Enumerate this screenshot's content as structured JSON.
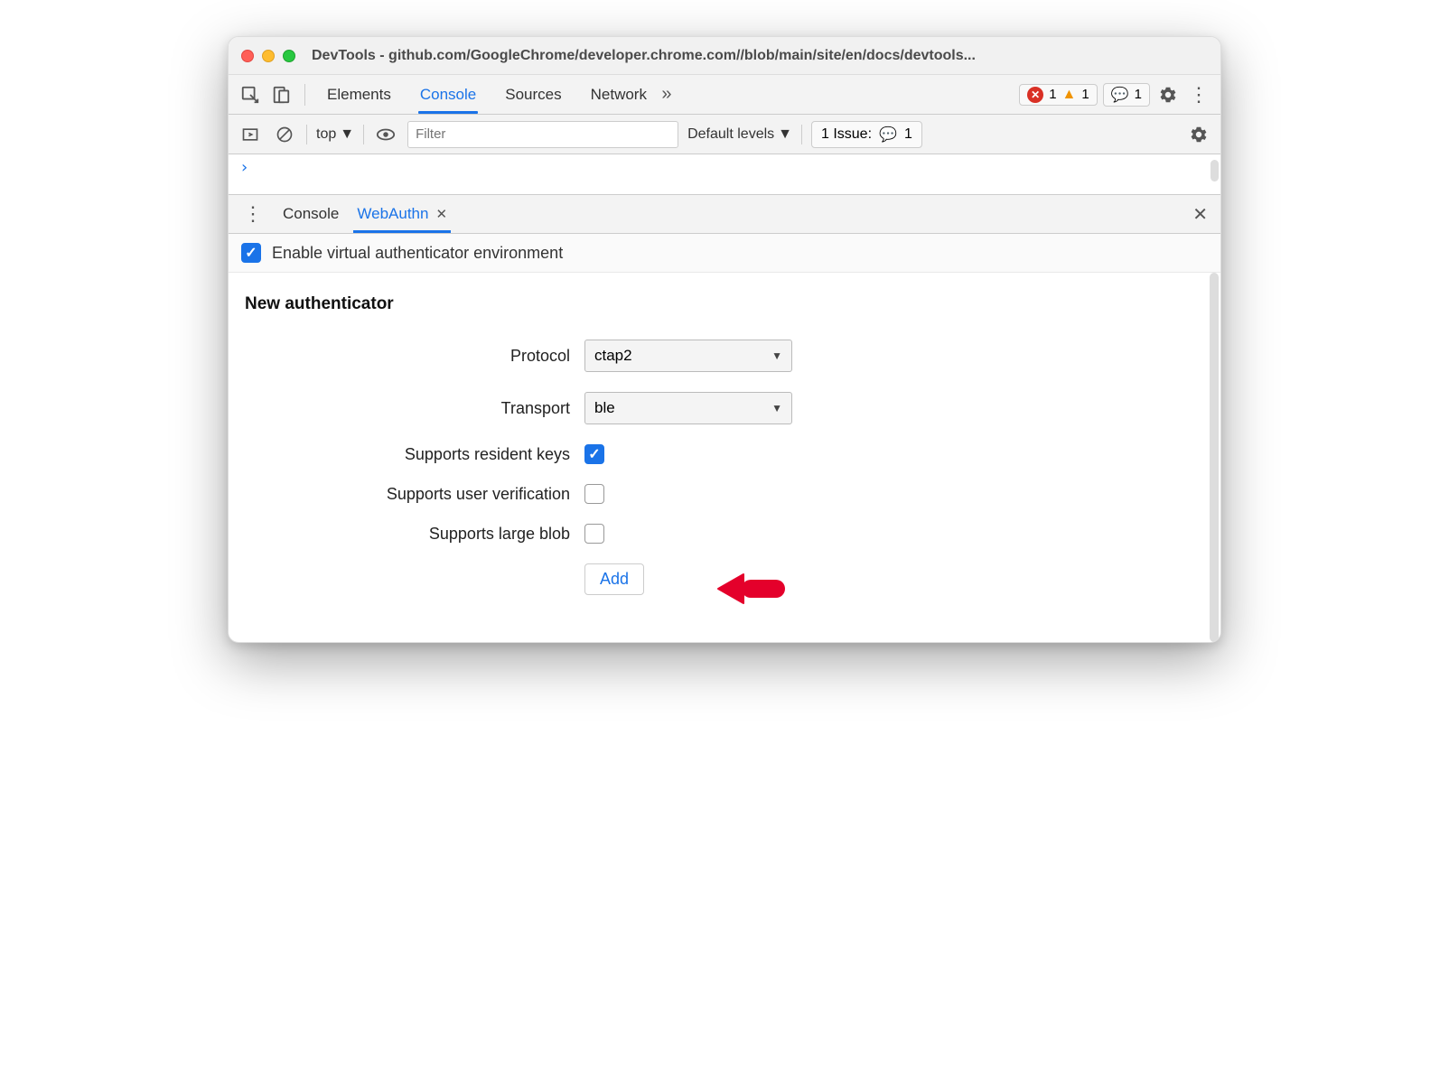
{
  "window": {
    "title": "DevTools - github.com/GoogleChrome/developer.chrome.com//blob/main/site/en/docs/devtools..."
  },
  "tabs": {
    "elements": "Elements",
    "console": "Console",
    "sources": "Sources",
    "network": "Network"
  },
  "badges": {
    "errors": "1",
    "warnings": "1",
    "issues_top": "1"
  },
  "console_toolbar": {
    "context": "top",
    "filter_placeholder": "Filter",
    "levels": "Default levels",
    "issues_label": "1 Issue:",
    "issues_count": "1"
  },
  "console_out": {
    "prompt": "›"
  },
  "drawer": {
    "tabs": {
      "console": "Console",
      "webauthn": "WebAuthn"
    },
    "enable_label": "Enable virtual authenticator environment",
    "section_title": "New authenticator",
    "form": {
      "protocol_label": "Protocol",
      "protocol_value": "ctap2",
      "transport_label": "Transport",
      "transport_value": "ble",
      "resident_label": "Supports resident keys",
      "userverif_label": "Supports user verification",
      "largeblob_label": "Supports large blob",
      "add_label": "Add"
    }
  }
}
